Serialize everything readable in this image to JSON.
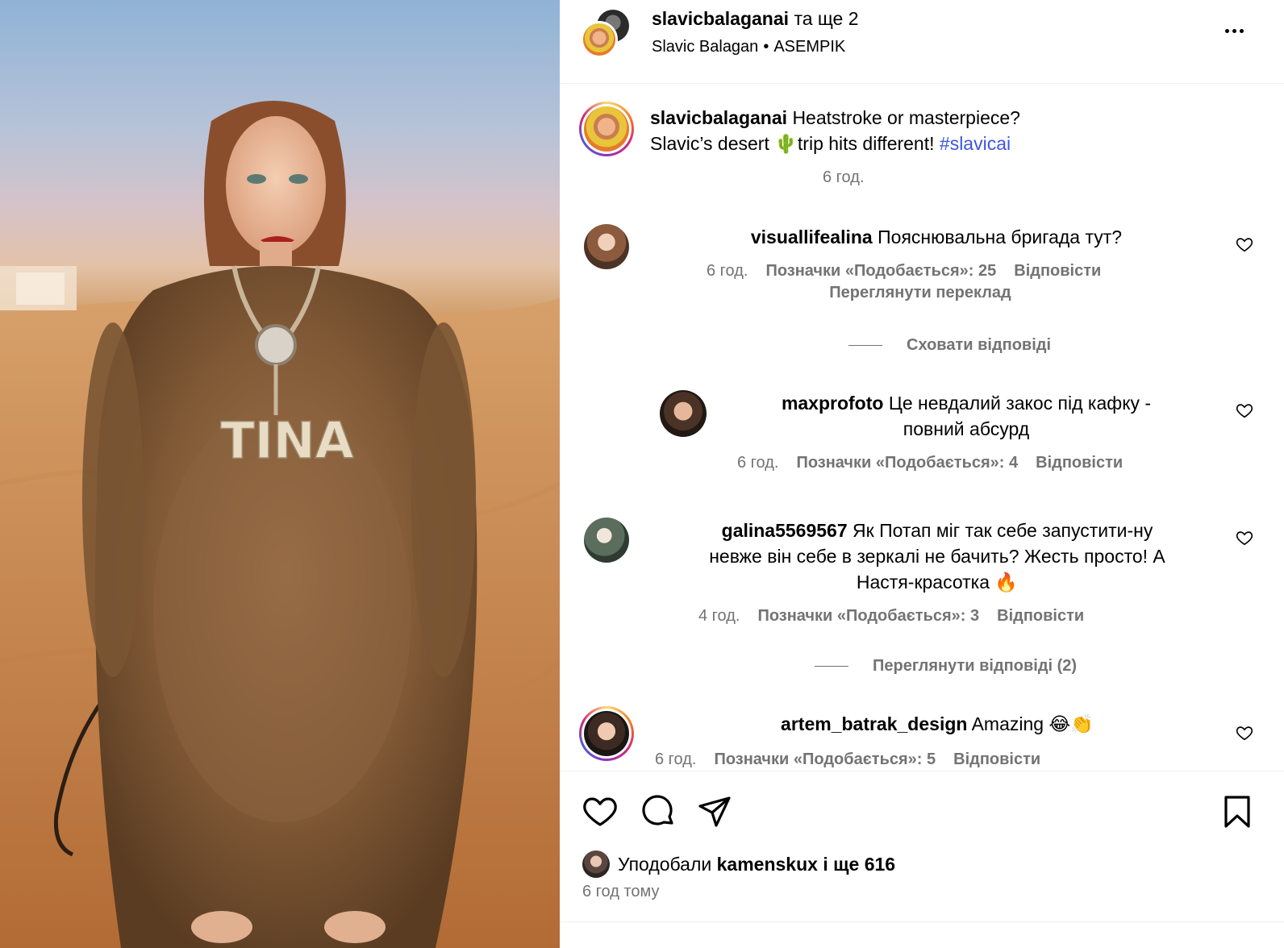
{
  "photo": {
    "name_on_coat": "TINA"
  },
  "header": {
    "username": "slavicbalaganai",
    "and_more": "та ще 2",
    "collaborators": [
      "Slavic Balagan",
      "ASEMPIK"
    ],
    "separator": "•"
  },
  "caption": {
    "username": "slavicbalaganai",
    "text_line1": "Heatstroke or masterpiece?",
    "text_line2_start": "Slavic’s desert",
    "emoji": "🌵",
    "text_line2_end": "trip hits different!",
    "hashtag": "#slavicai",
    "time": "6 год."
  },
  "comments": [
    {
      "username": "visuallifealina",
      "text": "Пояснювальна бригада тут?",
      "time": "6 год.",
      "likes": "Позначки «Подобається»: 25",
      "reply": "Відповісти",
      "translate": "Переглянути переклад",
      "toggle": "Сховати відповіді"
    },
    {
      "username": "maxprofoto",
      "text_line1": "Це невдалий закос під кафку -",
      "text_line2": "повний абсурд",
      "time": "6 год.",
      "likes": "Позначки «Подобається»: 4",
      "reply": "Відповісти"
    },
    {
      "username": "galina5569567",
      "text_line1": "Як Потап міг так себе запустити-ну",
      "text_line2": "невже він себе в зеркалі не бачить? Жесть просто! А",
      "text_line3": "Настя-красотка 🔥",
      "time": "4 год.",
      "likes": "Позначки «Подобається»: 3",
      "reply": "Відповісти",
      "toggle": "Переглянути відповіді (2)"
    },
    {
      "username": "artem_batrak_design",
      "text": "Amazing 😂👏",
      "time": "6 год.",
      "likes": "Позначки «Подобається»: 5",
      "reply": "Відповісти"
    }
  ],
  "footer": {
    "liked_prefix": "Уподобали",
    "liked_by": "kamenskux",
    "liked_suffix": "і ще 616",
    "posted": "6 год тому"
  },
  "icons": [
    "more-icon",
    "heart-icon",
    "comment-icon",
    "share-icon",
    "bookmark-icon"
  ],
  "colors": {
    "accent_link": "#3d55e0",
    "muted": "#737373"
  }
}
